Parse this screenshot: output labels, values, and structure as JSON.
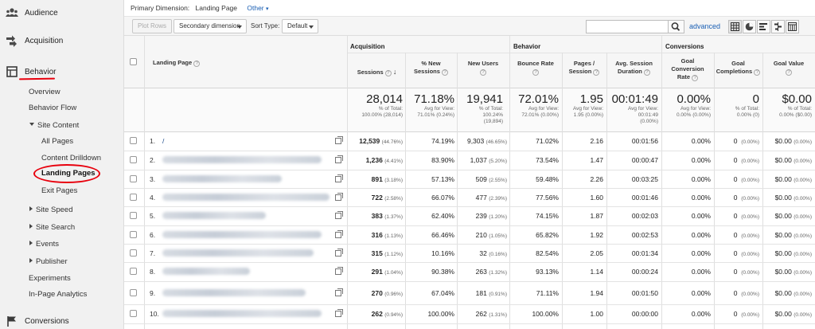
{
  "sidebar": {
    "audience": "Audience",
    "acquisition": "Acquisition",
    "behavior": "Behavior",
    "behavior_items": {
      "overview": "Overview",
      "behavior_flow": "Behavior Flow",
      "site_content": "Site Content",
      "all_pages": "All Pages",
      "content_drilldown": "Content Drilldown",
      "landing_pages": "Landing Pages",
      "exit_pages": "Exit Pages",
      "site_speed": "Site Speed",
      "site_search": "Site Search",
      "events": "Events",
      "publisher": "Publisher",
      "experiments": "Experiments",
      "in_page_analytics": "In-Page Analytics"
    },
    "conversions": "Conversions",
    "accent_color": "#e8000d"
  },
  "primary_dimension": {
    "label": "Primary Dimension:",
    "value": "Landing Page",
    "other": "Other"
  },
  "toolbar": {
    "plot_rows": "Plot Rows",
    "secondary_dimension": "Secondary dimension",
    "sort_type_label": "Sort Type:",
    "sort_type_value": "Default",
    "search_value": "",
    "advanced": "advanced"
  },
  "table": {
    "groups": {
      "acquisition": "Acquisition",
      "behavior": "Behavior",
      "conversions": "Conversions"
    },
    "landing_page_header": "Landing Page",
    "columns": {
      "sessions": "Sessions",
      "pct_new_sessions_1": "% New",
      "pct_new_sessions_2": "Sessions",
      "new_users": "New Users",
      "bounce_rate": "Bounce Rate",
      "pages_session_1": "Pages /",
      "pages_session_2": "Session",
      "avg_duration_1": "Avg. Session",
      "avg_duration_2": "Duration",
      "goal_conv_1": "Goal",
      "goal_conv_2": "Conversion",
      "goal_conv_3": "Rate",
      "goal_compl_1": "Goal",
      "goal_compl_2": "Completions",
      "goal_value": "Goal Value"
    },
    "totals": {
      "sessions": {
        "big": "28,014",
        "s1": "% of Total:",
        "s2": "100.00% (28,014)"
      },
      "pct_new": {
        "big": "71.18%",
        "s1": "Avg for View:",
        "s2": "71.01% (0.24%)"
      },
      "new_users": {
        "big": "19,941",
        "s1": "% of Total:",
        "s2": "100.24%",
        "s3": "(19,894)"
      },
      "bounce": {
        "big": "72.01%",
        "s1": "Avg for View:",
        "s2": "72.01% (0.00%)"
      },
      "pages": {
        "big": "1.95",
        "s1": "Avg for View:",
        "s2": "1.95 (0.00%)"
      },
      "duration": {
        "big": "00:01:49",
        "s1": "Avg for View:",
        "s2": "00:01:49",
        "s3": "(0.00%)"
      },
      "conv_rate": {
        "big": "0.00%",
        "s1": "Avg for View:",
        "s2": "0.00% (0.00%)"
      },
      "completions": {
        "big": "0",
        "s1": "% of Total:",
        "s2": "0.00% (0)"
      },
      "value": {
        "big": "$0.00",
        "s1": "% of Total:",
        "s2": "0.00% ($0.00)"
      }
    },
    "rows": [
      {
        "n": "1.",
        "page": "/",
        "sessions": "12,539",
        "sessions_pct": "(44.76%)",
        "pct_new": "74.19%",
        "new_users": "9,303",
        "new_users_pct": "(46.65%)",
        "bounce": "71.02%",
        "pages": "2.16",
        "duration": "00:01:56",
        "conv": "0.00%",
        "compl": "0",
        "compl_pct": "(0.00%)",
        "value": "$0.00",
        "value_pct": "(0.00%)"
      },
      {
        "n": "2.",
        "page": "",
        "sessions": "1,236",
        "sessions_pct": "(4.41%)",
        "pct_new": "83.90%",
        "new_users": "1,037",
        "new_users_pct": "(5.20%)",
        "bounce": "73.54%",
        "pages": "1.47",
        "duration": "00:00:47",
        "conv": "0.00%",
        "compl": "0",
        "compl_pct": "(0.00%)",
        "value": "$0.00",
        "value_pct": "(0.00%)"
      },
      {
        "n": "3.",
        "page": "",
        "sessions": "891",
        "sessions_pct": "(3.18%)",
        "pct_new": "57.13%",
        "new_users": "509",
        "new_users_pct": "(2.55%)",
        "bounce": "59.48%",
        "pages": "2.26",
        "duration": "00:03:25",
        "conv": "0.00%",
        "compl": "0",
        "compl_pct": "(0.00%)",
        "value": "$0.00",
        "value_pct": "(0.00%)"
      },
      {
        "n": "4.",
        "page": "",
        "sessions": "722",
        "sessions_pct": "(2.58%)",
        "pct_new": "66.07%",
        "new_users": "477",
        "new_users_pct": "(2.39%)",
        "bounce": "77.56%",
        "pages": "1.60",
        "duration": "00:01:46",
        "conv": "0.00%",
        "compl": "0",
        "compl_pct": "(0.00%)",
        "value": "$0.00",
        "value_pct": "(0.00%)"
      },
      {
        "n": "5.",
        "page": "",
        "sessions": "383",
        "sessions_pct": "(1.37%)",
        "pct_new": "62.40%",
        "new_users": "239",
        "new_users_pct": "(1.20%)",
        "bounce": "74.15%",
        "pages": "1.87",
        "duration": "00:02:03",
        "conv": "0.00%",
        "compl": "0",
        "compl_pct": "(0.00%)",
        "value": "$0.00",
        "value_pct": "(0.00%)"
      },
      {
        "n": "6.",
        "page": "",
        "sessions": "316",
        "sessions_pct": "(1.13%)",
        "pct_new": "66.46%",
        "new_users": "210",
        "new_users_pct": "(1.05%)",
        "bounce": "65.82%",
        "pages": "1.92",
        "duration": "00:02:53",
        "conv": "0.00%",
        "compl": "0",
        "compl_pct": "(0.00%)",
        "value": "$0.00",
        "value_pct": "(0.00%)"
      },
      {
        "n": "7.",
        "page": "",
        "sessions": "315",
        "sessions_pct": "(1.12%)",
        "pct_new": "10.16%",
        "new_users": "32",
        "new_users_pct": "(0.16%)",
        "bounce": "82.54%",
        "pages": "2.05",
        "duration": "00:01:34",
        "conv": "0.00%",
        "compl": "0",
        "compl_pct": "(0.00%)",
        "value": "$0.00",
        "value_pct": "(0.00%)"
      },
      {
        "n": "8.",
        "page": "",
        "sessions": "291",
        "sessions_pct": "(1.04%)",
        "pct_new": "90.38%",
        "new_users": "263",
        "new_users_pct": "(1.32%)",
        "bounce": "93.13%",
        "pages": "1.14",
        "duration": "00:00:24",
        "conv": "0.00%",
        "compl": "0",
        "compl_pct": "(0.00%)",
        "value": "$0.00",
        "value_pct": "(0.00%)"
      },
      {
        "n": "9.",
        "page": "",
        "sessions": "270",
        "sessions_pct": "(0.96%)",
        "pct_new": "67.04%",
        "new_users": "181",
        "new_users_pct": "(0.91%)",
        "bounce": "71.11%",
        "pages": "1.94",
        "duration": "00:01:50",
        "conv": "0.00%",
        "compl": "0",
        "compl_pct": "(0.00%)",
        "value": "$0.00",
        "value_pct": "(0.00%)"
      },
      {
        "n": "10.",
        "page": "",
        "sessions": "262",
        "sessions_pct": "(0.94%)",
        "pct_new": "100.00%",
        "new_users": "262",
        "new_users_pct": "(1.31%)",
        "bounce": "100.00%",
        "pages": "1.00",
        "duration": "00:00:00",
        "conv": "0.00%",
        "compl": "0",
        "compl_pct": "(0.00%)",
        "value": "$0.00",
        "value_pct": "(0.00%)"
      }
    ]
  }
}
